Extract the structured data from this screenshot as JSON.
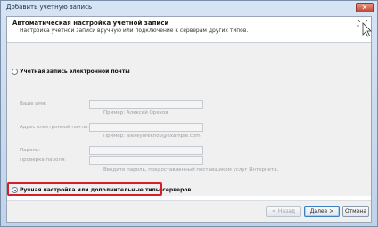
{
  "window": {
    "title": "Добавить учетную запись",
    "close_label": "✕"
  },
  "header": {
    "title": "Автоматическая настройка учетной записи",
    "subtitle": "Настройка учетной записи вручную или подключение к серверам других типов."
  },
  "email_account": {
    "option_label": "Учетная запись электронной почты",
    "fields": [
      {
        "label": "Ваше имя:",
        "value": "",
        "hint": "Пример: Алексей Орехов"
      },
      {
        "label": "Адрес электронной почты:",
        "value": "",
        "hint": "Пример: alexeyorekhov@example.com"
      },
      {
        "label": "Пароль:",
        "value": "",
        "hint": ""
      },
      {
        "label": "Проверка пароля:",
        "value": "",
        "hint": "Введите пароль, предоставленный поставщиком услуг Интернета."
      }
    ]
  },
  "manual_option": {
    "label": "Ручная настройка или дополнительные типы серверов",
    "selected": true
  },
  "buttons": {
    "back": "< Назад",
    "next": "Далее >",
    "cancel": "Отмена"
  }
}
